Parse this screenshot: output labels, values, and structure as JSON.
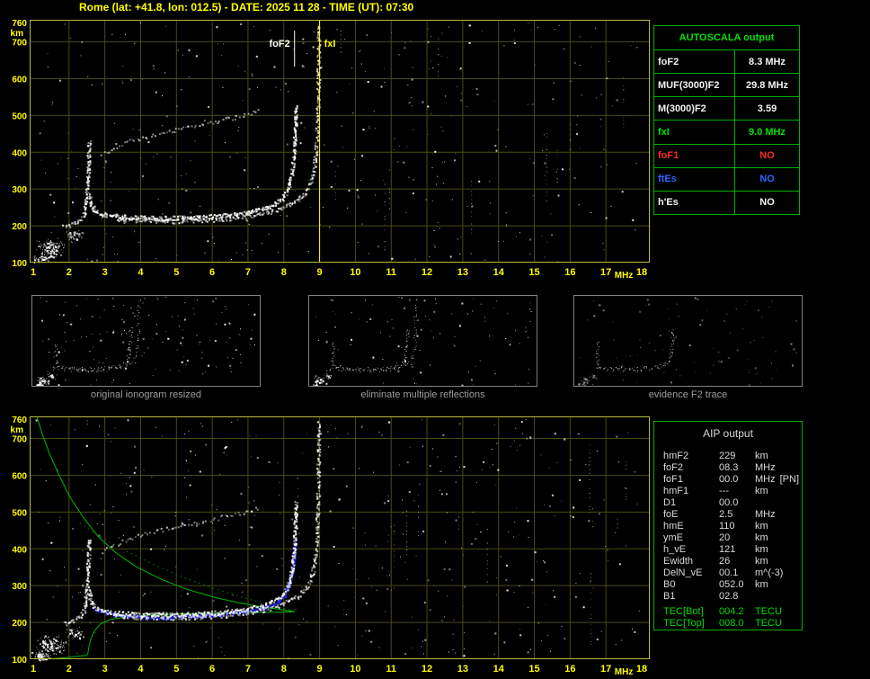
{
  "title": "Rome (lat: +41.8, lon: 012.5) - DATE: 2025 11 28 - TIME (UT): 07:30",
  "colors": {
    "background": "#000000",
    "axis": "#ffff00",
    "grid": "#4a4a12",
    "plot_border": "#b9b93e",
    "trace": "#ffffff",
    "profile_green": "#00bb00",
    "restored_blue": "#2222ff",
    "table_border": "#00b000"
  },
  "autoscala_table": {
    "title": "AUTOSCALA output",
    "rows": [
      {
        "label": "foF2",
        "value": "8.3 MHz",
        "color": "white"
      },
      {
        "label": "MUF(3000)F2",
        "value": "29.8 MHz",
        "color": "white"
      },
      {
        "label": "M(3000)F2",
        "value": "3.59",
        "color": "white"
      },
      {
        "label": "fxI",
        "value": "9.0 MHz",
        "color": "green"
      },
      {
        "label": "foF1",
        "value": "NO",
        "color": "red"
      },
      {
        "label": "ftEs",
        "value": "NO",
        "color": "blue"
      },
      {
        "label": "h'Es",
        "value": "NO",
        "color": "white"
      }
    ]
  },
  "aip_table": {
    "title": "AIP output",
    "rows": [
      {
        "label": "hmF2",
        "value": "229",
        "unit": "km"
      },
      {
        "label": "foF2",
        "value": "08.3",
        "unit": "MHz"
      },
      {
        "label": "foF1",
        "value": "00.0",
        "unit": "MHz",
        "note": "[PN]"
      },
      {
        "label": "hmF1",
        "value": "---",
        "unit": "km"
      },
      {
        "label": "D1",
        "value": "00.0",
        "unit": ""
      },
      {
        "label": "foE",
        "value": "2.5",
        "unit": "MHz"
      },
      {
        "label": "hmE",
        "value": "110",
        "unit": "km"
      },
      {
        "label": "ymE",
        "value": "20",
        "unit": "km"
      },
      {
        "label": "h_vE",
        "value": "121",
        "unit": "km"
      },
      {
        "label": "Ewidth",
        "value": "26",
        "unit": "km"
      },
      {
        "label": "DelN_vE",
        "value": "00.1",
        "unit": "m^(-3)"
      },
      {
        "label": "B0",
        "value": "052.0",
        "unit": "km"
      },
      {
        "label": "B1",
        "value": "02.8",
        "unit": ""
      },
      {
        "label": "TEC[Bot]",
        "value": "004.2",
        "unit": "TECU",
        "color": "green",
        "sep": true
      },
      {
        "label": "TEC[Top]",
        "value": "008.0",
        "unit": "TECU",
        "color": "green"
      }
    ]
  },
  "thumbnails": [
    {
      "caption": "original ionogram resized"
    },
    {
      "caption": "eliminate multiple reflections"
    },
    {
      "caption": "evidence F2 trace"
    }
  ],
  "chart_data": {
    "top_ionogram": {
      "type": "scatter",
      "title": "ionogram with AUTOSCALA markers",
      "xlabel": "MHz",
      "ylabel": "km",
      "xlim": [
        1,
        18
      ],
      "ylim": [
        100,
        760
      ],
      "xticks": [
        1,
        2,
        3,
        4,
        5,
        6,
        7,
        8,
        9,
        10,
        11,
        12,
        13,
        14,
        15,
        16,
        17,
        18
      ],
      "yticks": [
        760,
        700,
        600,
        500,
        400,
        300,
        200,
        100
      ],
      "grid": true,
      "markers": [
        {
          "label": "foF2",
          "x": 8.3,
          "color": "#ffffff",
          "full": false,
          "side": "left"
        },
        {
          "label": "fxI",
          "x": 9.0,
          "color": "#ffff00",
          "full": true,
          "side": "right"
        }
      ],
      "series": [
        {
          "name": "E-trace",
          "color": "#ffffff",
          "size": 2,
          "density": 0.8,
          "opacity": 0.9,
          "points": [
            [
              1.85,
              198
            ],
            [
              2.0,
              203
            ],
            [
              2.15,
              209
            ],
            [
              2.3,
              217
            ],
            [
              2.4,
              229
            ]
          ]
        },
        {
          "name": "E-cusp",
          "color": "#ffffff",
          "size": 2,
          "density": 1.0,
          "opacity": 0.95,
          "points": [
            [
              2.4,
              232
            ],
            [
              2.45,
              262
            ],
            [
              2.49,
              305
            ],
            [
              2.52,
              352
            ],
            [
              2.54,
              400
            ],
            [
              2.55,
              432
            ]
          ]
        },
        {
          "name": "O-trace",
          "color": "#ffffff",
          "size": 2,
          "density": 1.2,
          "opacity": 1,
          "points": [
            [
              2.55,
              285
            ],
            [
              2.6,
              258
            ],
            [
              2.7,
              243
            ],
            [
              2.9,
              233
            ],
            [
              3.2,
              228
            ],
            [
              3.8,
              224
            ],
            [
              4.5,
              222
            ],
            [
              5.2,
              223
            ],
            [
              5.8,
              226
            ],
            [
              6.4,
              230
            ],
            [
              6.9,
              236
            ],
            [
              7.3,
              244
            ],
            [
              7.6,
              254
            ],
            [
              7.9,
              270
            ],
            [
              8.05,
              290
            ],
            [
              8.15,
              316
            ],
            [
              8.22,
              350
            ],
            [
              8.27,
              392
            ],
            [
              8.3,
              440
            ],
            [
              8.32,
              492
            ],
            [
              8.33,
              528
            ]
          ]
        },
        {
          "name": "X-trace",
          "color": "#ffffff",
          "size": 2,
          "density": 0.8,
          "opacity": 0.85,
          "points": [
            [
              3.3,
              219
            ],
            [
              4.0,
              216
            ],
            [
              4.8,
              214
            ],
            [
              5.6,
              216
            ],
            [
              6.3,
              220
            ],
            [
              6.9,
              226
            ],
            [
              7.4,
              234
            ],
            [
              7.8,
              246
            ],
            [
              8.1,
              259
            ],
            [
              8.4,
              274
            ],
            [
              8.6,
              292
            ],
            [
              8.75,
              320
            ],
            [
              8.85,
              365
            ],
            [
              8.9,
              425
            ],
            [
              8.93,
              500
            ],
            [
              8.95,
              585
            ],
            [
              8.96,
              672
            ],
            [
              8.97,
              748
            ]
          ]
        },
        {
          "name": "second-hop",
          "color": "#ffffff",
          "size": 2,
          "density": 0.32,
          "opacity": 0.75,
          "points": [
            [
              2.9,
              395
            ],
            [
              3.4,
              420
            ],
            [
              3.9,
              438
            ],
            [
              4.4,
              450
            ],
            [
              4.9,
              460
            ],
            [
              5.4,
              470
            ],
            [
              5.9,
              480
            ],
            [
              6.4,
              492
            ],
            [
              6.9,
              503
            ],
            [
              7.35,
              515
            ]
          ]
        }
      ],
      "noise": {
        "uniform": 400,
        "streaks": 10,
        "clusters": [
          [
            1.5,
            140,
            0.45,
            30,
            120
          ],
          [
            2.15,
            172,
            0.3,
            18,
            40
          ],
          [
            1.2,
            110,
            0.3,
            12,
            50
          ]
        ]
      }
    },
    "bottom_ionogram": {
      "type": "scatter",
      "title": "ionogram with AIP electron density profile",
      "xlabel": "MHz",
      "ylabel": "km",
      "xlim": [
        1,
        18
      ],
      "ylim": [
        100,
        760
      ],
      "xticks": [
        1,
        2,
        3,
        4,
        5,
        6,
        7,
        8,
        9,
        10,
        11,
        12,
        13,
        14,
        15,
        16,
        17,
        18
      ],
      "yticks": [
        760,
        700,
        600,
        500,
        400,
        300,
        200,
        100
      ],
      "grid": true,
      "series_ref": "top_ionogram",
      "profiles": [
        {
          "name": "topside-profile",
          "color": "#00bb00",
          "style": "solid",
          "points": [
            [
              8.3,
              229
            ],
            [
              8.0,
              234
            ],
            [
              7.4,
              242
            ],
            [
              6.7,
              254
            ],
            [
              6.0,
              270
            ],
            [
              5.3,
              290
            ],
            [
              4.6,
              316
            ],
            [
              3.9,
              350
            ],
            [
              3.3,
              390
            ],
            [
              2.8,
              435
            ],
            [
              2.4,
              485
            ],
            [
              2.0,
              545
            ],
            [
              1.7,
              605
            ],
            [
              1.45,
              660
            ],
            [
              1.25,
              712
            ],
            [
              1.1,
              760
            ]
          ]
        },
        {
          "name": "bottomside-profile",
          "color": "#00bb00",
          "style": "solid",
          "points": [
            [
              2.52,
              112
            ],
            [
              2.56,
              136
            ],
            [
              2.62,
              158
            ],
            [
              2.72,
              178
            ],
            [
              2.88,
              196
            ],
            [
              3.15,
              208
            ],
            [
              3.6,
              215
            ],
            [
              4.3,
              220
            ],
            [
              5.1,
              223
            ],
            [
              6.0,
              225
            ],
            [
              7.0,
              227
            ],
            [
              8.0,
              228
            ],
            [
              8.3,
              229
            ]
          ]
        },
        {
          "name": "e-layer-profile",
          "color": "#00bb00",
          "style": "solid",
          "points": [
            [
              1.3,
              100
            ],
            [
              1.6,
              102
            ],
            [
              1.9,
              104
            ],
            [
              2.15,
              107
            ],
            [
              2.35,
              109
            ],
            [
              2.5,
              110
            ],
            [
              2.52,
              110
            ]
          ]
        },
        {
          "name": "model-profile",
          "color": "#007f00",
          "style": "dotted",
          "points": [
            [
              2.3,
              470
            ],
            [
              2.9,
              432
            ],
            [
              3.6,
              394
            ],
            [
              4.4,
              356
            ],
            [
              5.2,
              322
            ],
            [
              6.0,
              294
            ],
            [
              6.8,
              270
            ],
            [
              7.5,
              250
            ],
            [
              8.1,
              236
            ],
            [
              8.3,
              230
            ]
          ]
        }
      ],
      "restored_trace": {
        "name": "autoscala-restored-trace",
        "color": "#2222ff",
        "points": [
          [
            2.7,
            238
          ],
          [
            3.0,
            228
          ],
          [
            3.4,
            221
          ],
          [
            4.0,
            217
          ],
          [
            4.6,
            216
          ],
          [
            5.2,
            218
          ],
          [
            5.8,
            221
          ],
          [
            6.4,
            226
          ],
          [
            7.0,
            233
          ],
          [
            7.4,
            242
          ],
          [
            7.8,
            258
          ],
          [
            8.0,
            277
          ],
          [
            8.1,
            298
          ],
          [
            8.2,
            338
          ],
          [
            8.26,
            385
          ],
          [
            8.3,
            428
          ]
        ]
      },
      "noise": {
        "uniform": 430,
        "streaks": 10,
        "clusters": [
          [
            1.5,
            140,
            0.45,
            30,
            130
          ],
          [
            2.15,
            172,
            0.3,
            18,
            45
          ],
          [
            1.2,
            110,
            0.3,
            12,
            70
          ]
        ]
      }
    }
  }
}
